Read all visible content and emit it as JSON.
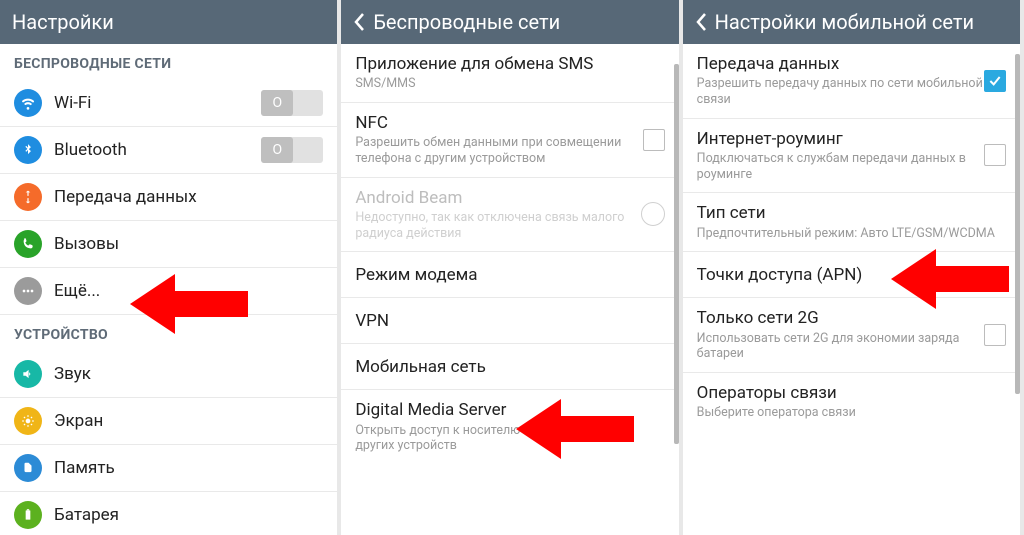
{
  "screen1": {
    "header": "Настройки",
    "section_wireless": "БЕСПРОВОДНЫЕ СЕТИ",
    "section_device": "УСТРОЙСТВО",
    "items": {
      "wifi": "Wi-Fi",
      "bluetooth": "Bluetooth",
      "data": "Передача данных",
      "calls": "Вызовы",
      "more": "Ещё...",
      "sound": "Звук",
      "screen": "Экран",
      "memory": "Память",
      "battery": "Батарея"
    },
    "toggle_off_label": "O"
  },
  "screen2": {
    "header": "Беспроводные сети",
    "items": {
      "sms": {
        "title": "Приложение для обмена SMS",
        "sub": "SMS/MMS"
      },
      "nfc": {
        "title": "NFC",
        "sub": "Разрешить обмен данными при совмещении телефона с другим устройством"
      },
      "beam": {
        "title": "Android Beam",
        "sub": "Недоступно, так как отключена связь малого радиуса действия"
      },
      "tether": {
        "title": "Режим модема"
      },
      "vpn": {
        "title": "VPN"
      },
      "mobile": {
        "title": "Мобильная сеть"
      },
      "dms": {
        "title": "Digital Media Server",
        "sub": "Открыть доступ к носителю информации для других устройств"
      }
    }
  },
  "screen3": {
    "header": "Настройки мобильной сети",
    "items": {
      "data": {
        "title": "Передача данных",
        "sub": "Разрешить передачу данных по сети мобильной связи"
      },
      "roaming": {
        "title": "Интернет-роуминг",
        "sub": "Подключаться к службам передачи данных в роуминге"
      },
      "nettype": {
        "title": "Тип сети",
        "sub": "Предпочтительный режим: Авто LTE/GSM/WCDMA"
      },
      "apn": {
        "title": "Точки доступа (APN)"
      },
      "only2g": {
        "title": "Только сети 2G",
        "sub": "Использовать сети 2G для экономии заряда батареи"
      },
      "operators": {
        "title": "Операторы связи",
        "sub": "Выберите оператора связи"
      }
    }
  }
}
